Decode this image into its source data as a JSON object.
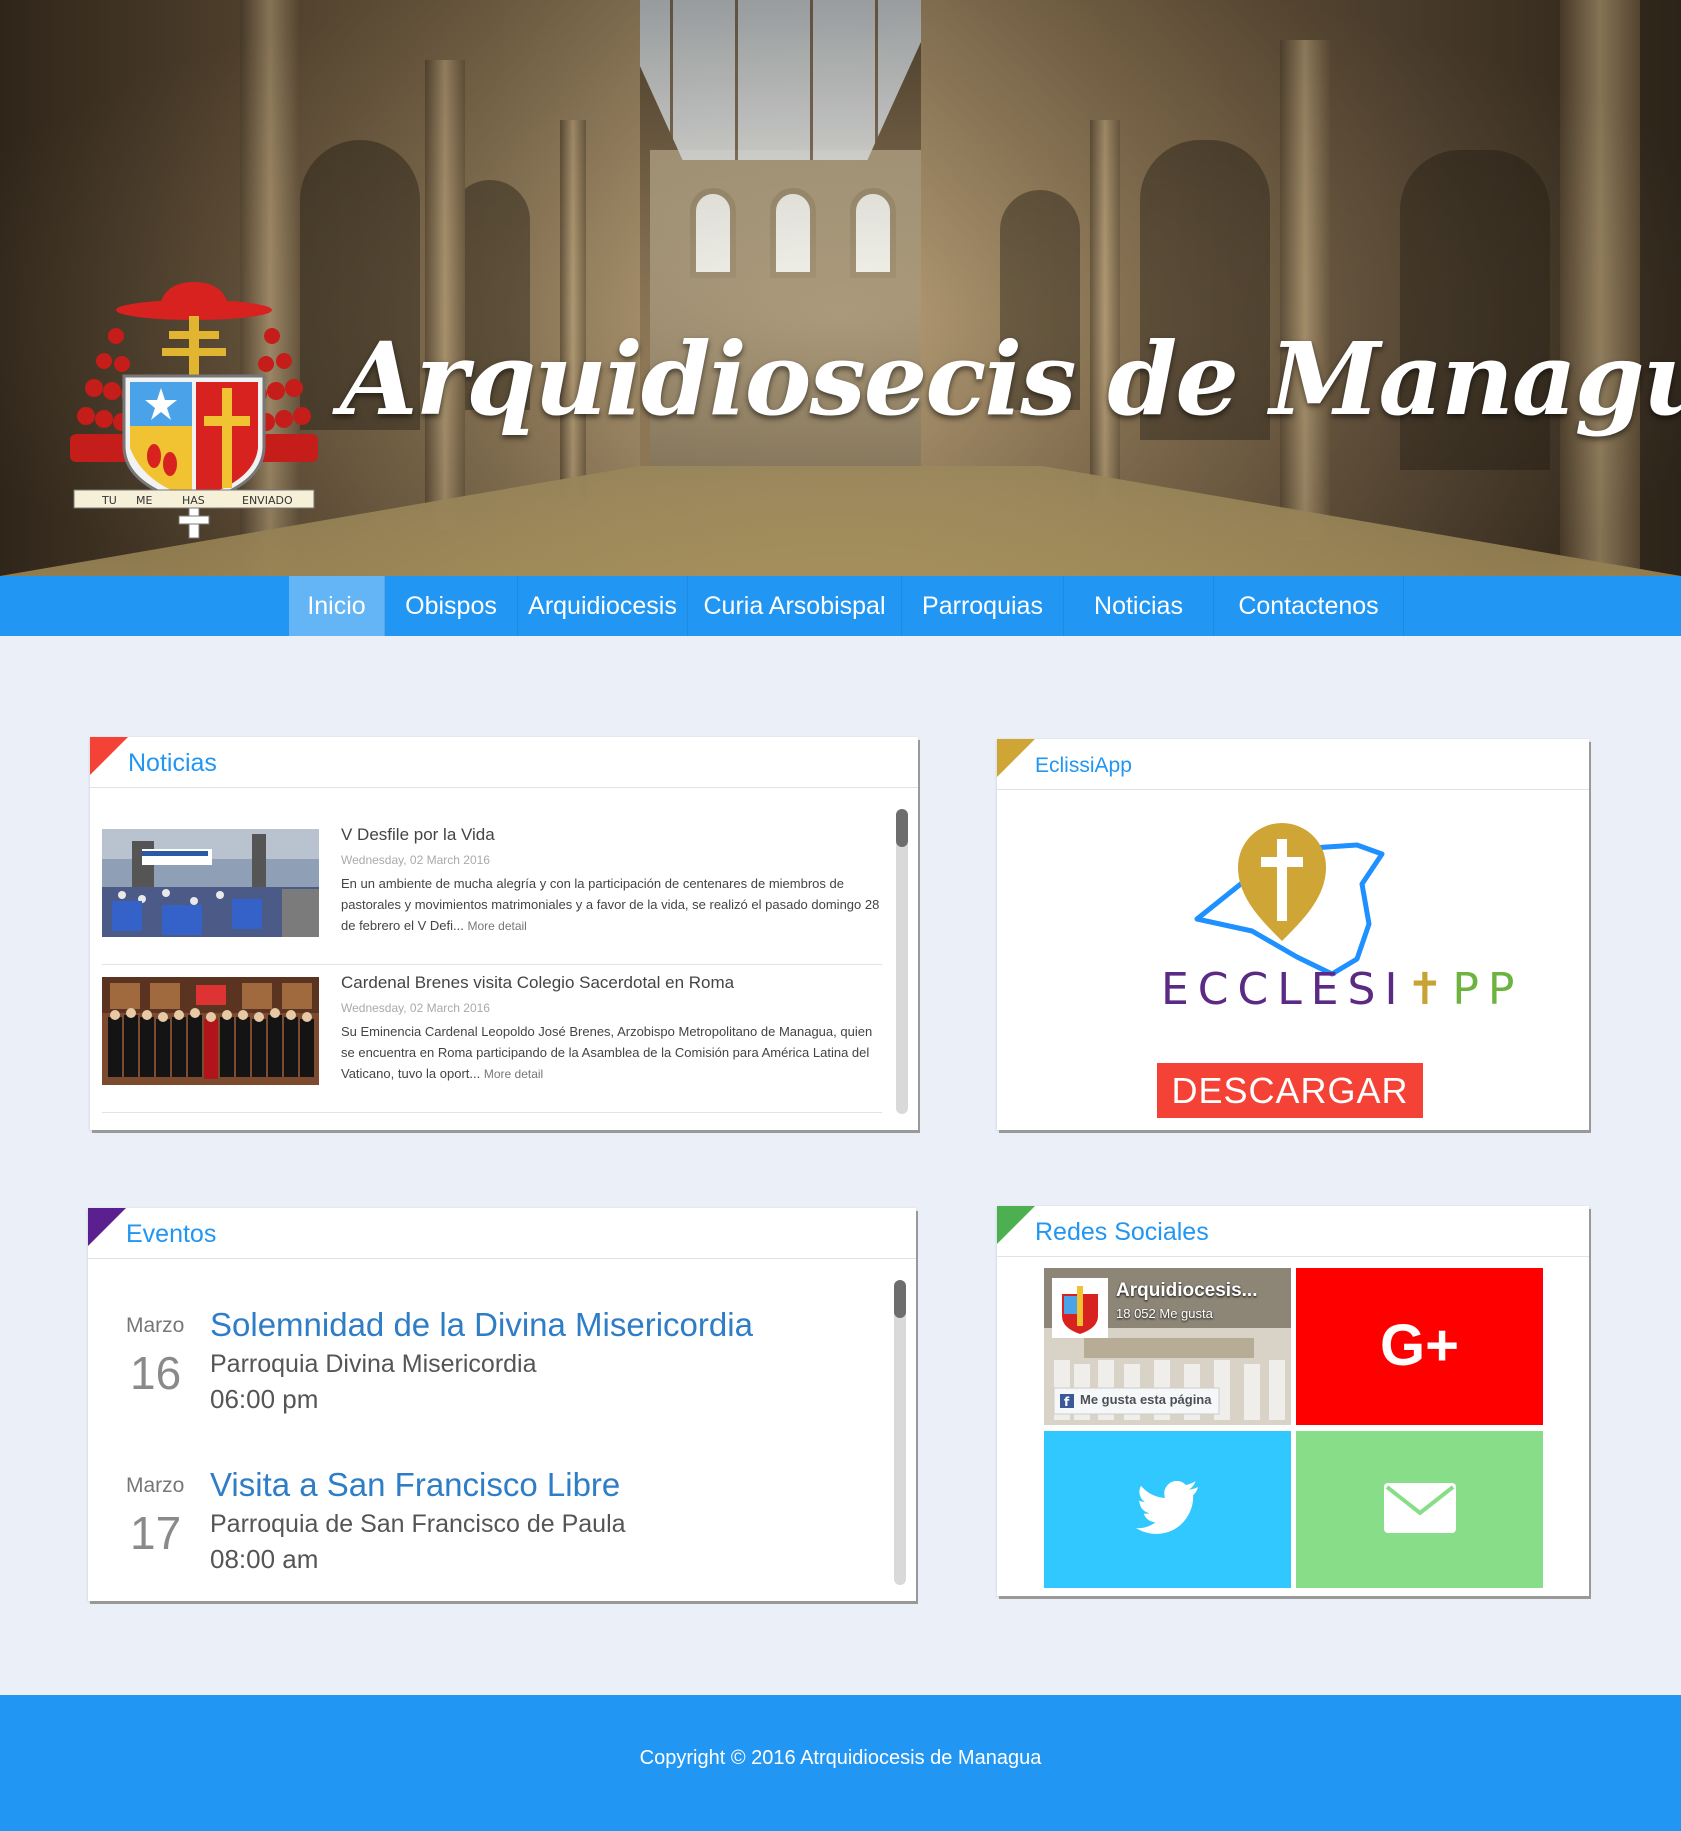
{
  "header": {
    "site_title": "Arquidiosecis de Managua",
    "crest_motto": [
      "TU",
      "ME",
      "HAS",
      "ENVIADO"
    ]
  },
  "nav": {
    "items": [
      {
        "label": "Inicio",
        "active": true
      },
      {
        "label": "Obispos"
      },
      {
        "label": "Arquidiocesis"
      },
      {
        "label": "Curia Arsobispal"
      },
      {
        "label": "Parroquias"
      },
      {
        "label": "Noticias"
      },
      {
        "label": "Contactenos"
      }
    ]
  },
  "news": {
    "title": "Noticias",
    "accent": "#f44336",
    "items": [
      {
        "title": "V Desfile por la Vida",
        "date": "Wednesday, 02 March 2016",
        "body": "En un ambiente de mucha alegría y con la participación de centenares de miembros de pastorales y movimientos matrimoniales y a favor de la vida, se realizó el pasado domingo 28 de febrero el V Defi...",
        "more": "More detail"
      },
      {
        "title": "Cardenal Brenes visita Colegio Sacerdotal en Roma",
        "date": "Wednesday, 02 March 2016",
        "body": "Su Eminencia Cardenal Leopoldo José Brenes, Arzobispo Metropolitano de Managua, quien se encuentra en Roma participando de la Asamblea de la Comisión para América Latina del Vaticano, tuvo la oport...",
        "more": "More detail"
      }
    ]
  },
  "app": {
    "title": "EclissiApp",
    "accent": "#cfa636",
    "logo_word_a": "ECCLESI",
    "logo_word_b": "PP",
    "button": "DESCARGAR"
  },
  "events": {
    "title": "Eventos",
    "accent": "#5c1f8f",
    "items": [
      {
        "month": "Marzo",
        "day": "16",
        "title": "Solemnidad de la Divina Misericordia",
        "place": "Parroquia Divina Misericordia",
        "time": "06:00 pm"
      },
      {
        "month": "Marzo",
        "day": "17",
        "title": "Visita a San Francisco Libre",
        "place": "Parroquia de San Francisco de Paula",
        "time": "08:00 am"
      }
    ]
  },
  "social": {
    "title": "Redes Sociales",
    "accent": "#4caf50",
    "facebook": {
      "page_name": "Arquidiocesis...",
      "likes": "18 052 Me gusta",
      "like_button": "Me gusta esta página"
    },
    "gplus_label": "G+",
    "colors": {
      "gplus": "#ff0000",
      "twitter": "#30c8ff",
      "mail": "#88dd88"
    }
  },
  "footer": {
    "copyright": "Copyright © 2016 Atrquidiocesis de Managua"
  }
}
